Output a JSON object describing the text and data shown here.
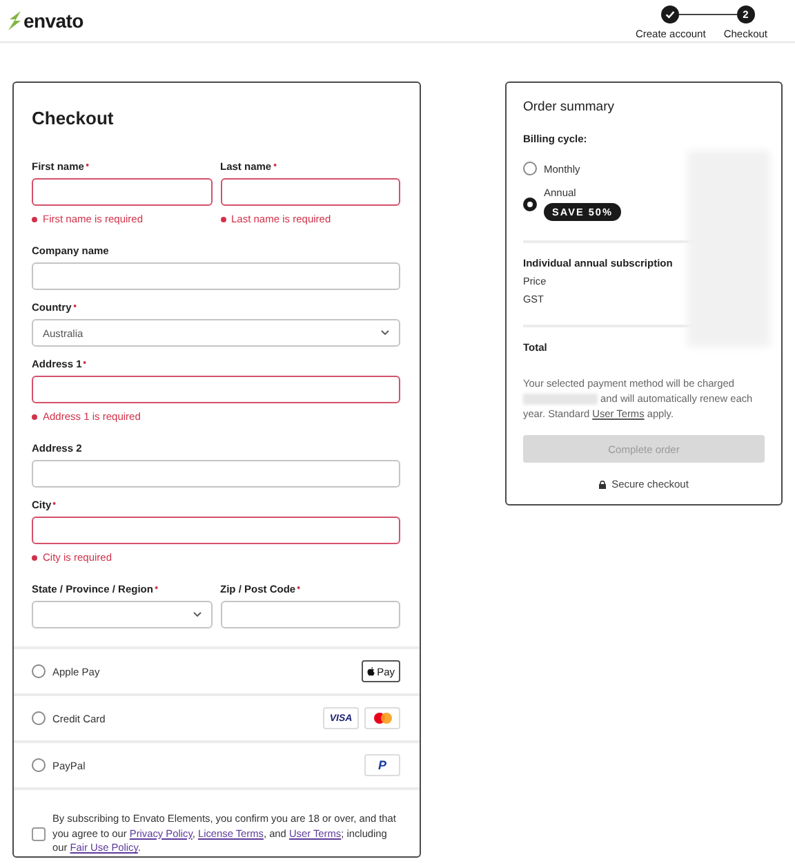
{
  "header": {
    "brand": "envato",
    "steps": [
      {
        "label": "Create account",
        "completed": true
      },
      {
        "label": "Checkout",
        "completed": false,
        "number": "2"
      }
    ]
  },
  "checkout": {
    "title": "Checkout",
    "rows": [
      [
        {
          "kind": "text",
          "label": "First name",
          "required": true,
          "invalid": true,
          "error": "First name is required"
        },
        {
          "kind": "text",
          "label": "Last name",
          "required": true,
          "invalid": true,
          "error": "Last name is required"
        }
      ],
      [
        {
          "kind": "text",
          "label": "Company name",
          "required": false,
          "invalid": false
        }
      ],
      [
        {
          "kind": "select",
          "label": "Country",
          "required": true,
          "invalid": false,
          "value": "Australia"
        }
      ],
      [
        {
          "kind": "text",
          "label": "Address 1",
          "required": true,
          "invalid": true,
          "error": "Address 1 is required"
        }
      ],
      [
        {
          "kind": "text",
          "label": "Address 2",
          "required": false,
          "invalid": false
        }
      ],
      [
        {
          "kind": "text",
          "label": "City",
          "required": true,
          "invalid": true,
          "error": "City is required"
        }
      ],
      [
        {
          "kind": "select",
          "label": "State / Province / Region",
          "required": true,
          "invalid": false
        },
        {
          "kind": "text",
          "label": "Zip / Post Code",
          "required": true,
          "invalid": false
        }
      ]
    ],
    "payments": [
      {
        "label": "Apple Pay",
        "selected": false,
        "logos": [
          {
            "kind": "apple",
            "text": "Pay"
          }
        ]
      },
      {
        "label": "Credit Card",
        "selected": false,
        "logos": [
          {
            "kind": "visa",
            "text": "VISA"
          },
          {
            "kind": "mastercard"
          }
        ]
      },
      {
        "label": "PayPal",
        "selected": false,
        "logos": [
          {
            "kind": "paypal",
            "text": "P"
          }
        ]
      }
    ],
    "terms": {
      "checked": false,
      "parts": [
        {
          "kind": "text",
          "text": "By subscribing to Envato Elements, you confirm you are 18 or over, and that you agree to our "
        },
        {
          "kind": "link",
          "text": "Privacy Policy"
        },
        {
          "kind": "text",
          "text": ", "
        },
        {
          "kind": "link",
          "text": "License Terms"
        },
        {
          "kind": "text",
          "text": ", and "
        },
        {
          "kind": "link",
          "text": "User Terms"
        },
        {
          "kind": "text",
          "text": "; including our "
        },
        {
          "kind": "link",
          "text": "Fair Use Policy"
        },
        {
          "kind": "text",
          "text": "."
        }
      ]
    }
  },
  "summary": {
    "title": "Order summary",
    "billing_label": "Billing cycle:",
    "cycles": [
      {
        "label": "Monthly",
        "selected": false
      },
      {
        "label": "Annual",
        "selected": true,
        "badge": "SAVE 50%"
      }
    ],
    "subscription": "Individual annual subscription",
    "lines": [
      "Price",
      "GST"
    ],
    "total": "Total",
    "notice": [
      {
        "kind": "text",
        "text": "Your selected payment method will be charged "
      },
      {
        "kind": "redacted"
      },
      {
        "kind": "text",
        "text": " and will automatically renew each year. Standard "
      },
      {
        "kind": "link",
        "text": "User Terms"
      },
      {
        "kind": "text",
        "text": " apply."
      }
    ],
    "button": {
      "label": "Complete order",
      "disabled": true
    },
    "secure": "Secure checkout"
  }
}
